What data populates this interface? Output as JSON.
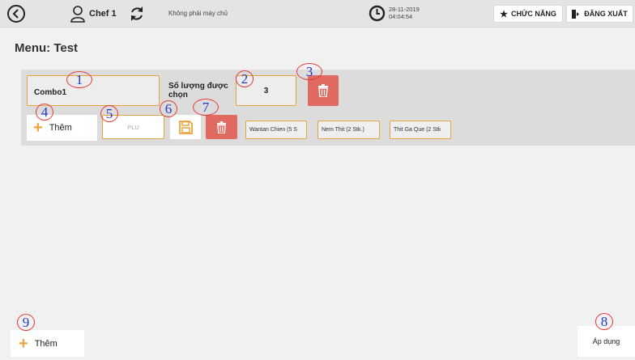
{
  "topbar": {
    "user_name": "Chef 1",
    "server_status": "Không phải máy chủ",
    "date": "28-11-2019",
    "time": "04:04:54",
    "functions_label": "CHỨC NĂNG",
    "logout_label": "ĐĂNG XUẤT"
  },
  "page": {
    "title": "Menu: Test"
  },
  "combo": {
    "name": "Combo1",
    "quantity_label": "Số lượng được chọn",
    "quantity_value": "3",
    "add_item_label": "Thêm",
    "plu_placeholder": "PLU",
    "items": [
      "Wantan Chien (5 S",
      "Nem Thit (2 Stk.)",
      "Thit Ga Que (2 Stk"
    ]
  },
  "footer": {
    "add_combo_label": "Thêm",
    "apply_label": "Áp dụng"
  },
  "markers": [
    "1",
    "2",
    "3",
    "4",
    "5",
    "6",
    "7",
    "8",
    "9"
  ],
  "colors": {
    "accent_orange": "#e6a23c",
    "delete_red": "#e06a5f",
    "marker_red": "#e03a3a",
    "marker_blue": "#2236c8"
  },
  "icons": [
    "back-icon",
    "user-icon",
    "sync-icon",
    "clock-icon",
    "star-icon",
    "logout-icon",
    "trash-icon",
    "plus-icon",
    "save-icon"
  ]
}
